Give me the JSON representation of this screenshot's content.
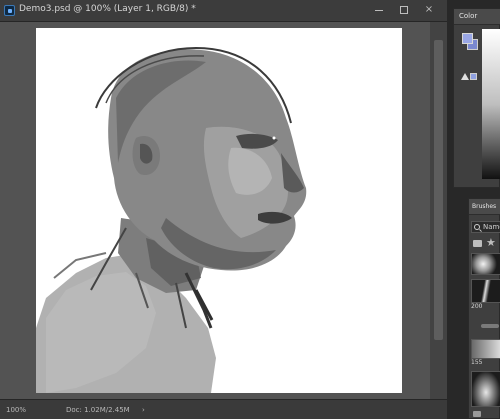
{
  "document": {
    "title": "Demo3.psd @ 100% (Layer 1, RGB/8) *",
    "window_buttons": {
      "close": "×"
    }
  },
  "status": {
    "zoom": "100%",
    "doc_info": "Doc: 1.02M/2.45M",
    "arrow": "›"
  },
  "panels": {
    "color": {
      "tab_label": "Color"
    },
    "brushes": {
      "tab_label": "Brushes",
      "search_placeholder": "Name",
      "sizes": [
        "200",
        "",
        "155"
      ]
    }
  },
  "colors": {
    "foreground": "#9aa7e6",
    "background": "#7a88d0",
    "app_bg": "#535353",
    "panel_bg": "#3f3f3f"
  },
  "icons": [
    "photoshop-icon",
    "search-icon",
    "folder-icon",
    "star-icon",
    "warning-triangle-icon"
  ]
}
